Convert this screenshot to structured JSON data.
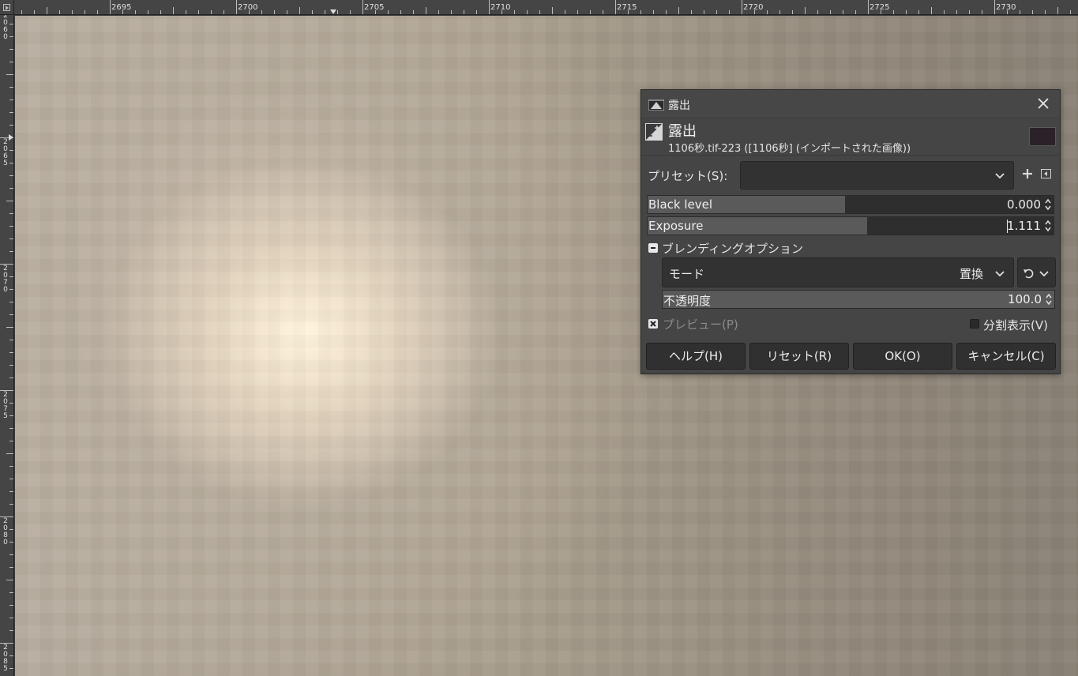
{
  "ruler": {
    "h_labels": [
      "2695",
      "2700",
      "2705",
      "2710",
      "2715",
      "2720",
      "2725",
      "2730"
    ],
    "v_labels": [
      "2060",
      "2065",
      "2070",
      "2075",
      "2080",
      "2085"
    ]
  },
  "dialog": {
    "window_title": "露出",
    "header_title": "露出",
    "header_subtitle": "1106秒.tif-223 ([1106秒] (インポートされた画像))",
    "preset_label": "プリセット(S):",
    "preset_value": "",
    "black_level": {
      "label": "Black level",
      "value": "0.000",
      "fraction": 0.487
    },
    "exposure": {
      "label": "Exposure",
      "value": "1.111",
      "fraction": 0.541
    },
    "blending_label": "ブレンディングオプション",
    "mode_label": "モード",
    "mode_value": "置換",
    "opacity": {
      "label": "不透明度",
      "value": "100.0",
      "fraction": 1.0
    },
    "preview_label": "プレビュー(P)",
    "preview_checked": true,
    "split_label": "分割表示(V)",
    "split_checked": false,
    "buttons": {
      "help": "ヘルプ(H)",
      "reset": "リセット(R)",
      "ok": "OK(O)",
      "cancel": "キャンセル(C)"
    }
  },
  "icons": [
    "menu-arrow-icon",
    "exposure-icon",
    "close-icon",
    "chevron-down-icon",
    "add-icon",
    "preset-menu-icon",
    "spin-arrows-icon",
    "composite-mode-icon",
    "check-icon"
  ],
  "colors": {
    "canvas_bright": "#fff3dc",
    "canvas_mid": "#cfc3ae",
    "canvas_dark": "#8f8678",
    "dialog_bg": "#454545"
  }
}
